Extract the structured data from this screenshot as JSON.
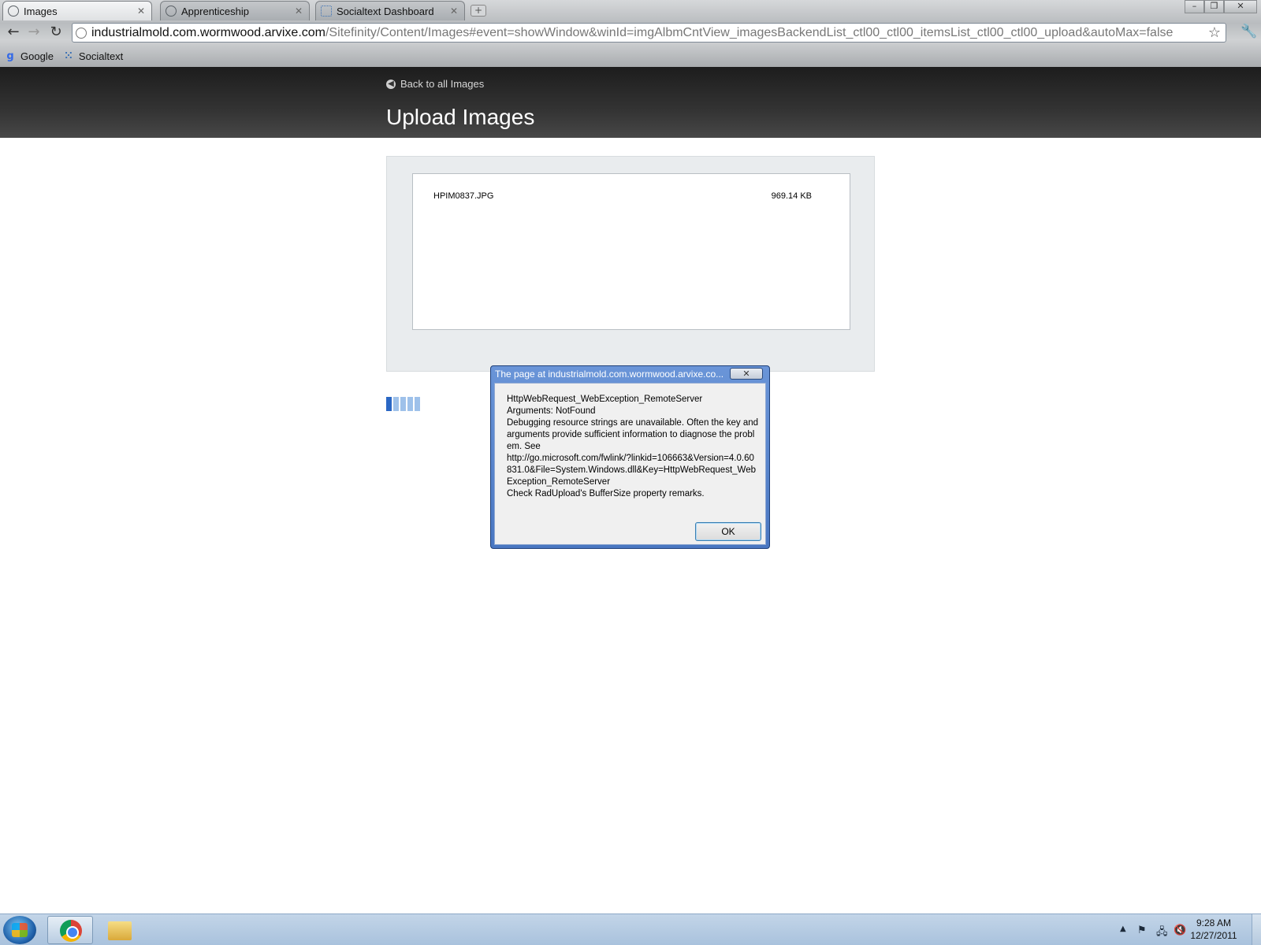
{
  "browser": {
    "tabs": [
      {
        "title": "Images",
        "active": true
      },
      {
        "title": "Apprenticeship",
        "active": false
      },
      {
        "title": "Socialtext Dashboard",
        "active": false
      }
    ],
    "address": {
      "host": "industrialmold.com.wormwood.arvixe.com",
      "path": "/Sitefinity/Content/Images#event=showWindow&winId=imgAlbmCntView_imagesBackendList_ctl00_ctl00_itemsList_ctl00_ctl00_upload&autoMax=false"
    },
    "bookmarks": [
      {
        "label": "Google",
        "icon": "google-icon"
      },
      {
        "label": "Socialtext",
        "icon": "socialtext-icon"
      }
    ]
  },
  "page": {
    "back_link": "Back to all Images",
    "title": "Upload Images",
    "files": [
      {
        "name": "HPIM0837.JPG",
        "size": "969.14 KB"
      }
    ]
  },
  "dialog": {
    "title": "The page at industrialmold.com.wormwood.arvixe.co...",
    "message": "HttpWebRequest_WebException_RemoteServer\nArguments: NotFound\nDebugging resource strings are unavailable. Often the key and arguments provide sufficient information to diagnose the problem. See\nhttp://go.microsoft.com/fwlink/?linkid=106663&Version=4.0.60831.0&File=System.Windows.dll&Key=HttpWebRequest_WebException_RemoteServer\nCheck RadUpload's BufferSize property remarks.",
    "ok_label": "OK"
  },
  "taskbar": {
    "time": "9:28 AM",
    "date": "12/27/2011"
  },
  "colors": {
    "header_dark": "#2b2b2b",
    "dialog_blue": "#4a77c2",
    "spinner_active": "#2a67c4"
  }
}
